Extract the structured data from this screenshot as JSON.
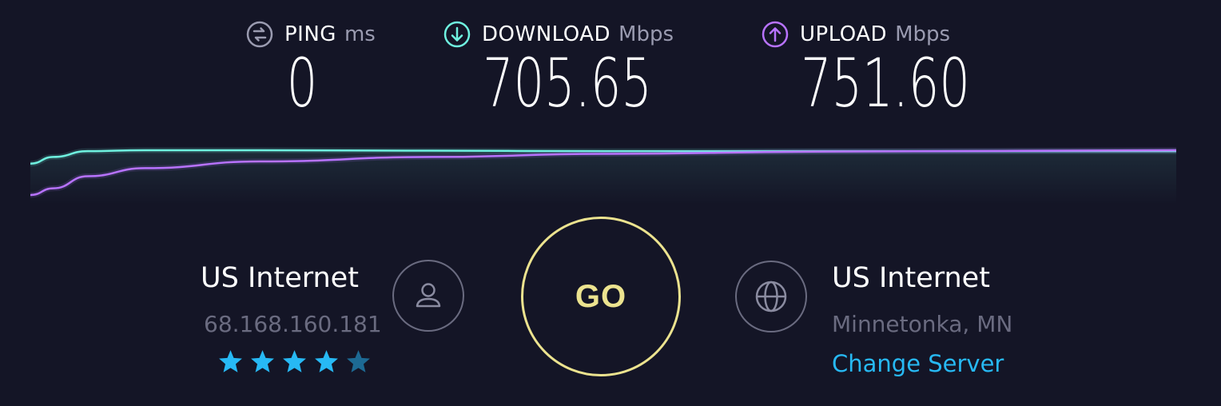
{
  "metrics": {
    "ping": {
      "label": "PING",
      "unit": "ms",
      "value": "0",
      "icon": "ping-icon"
    },
    "download": {
      "label": "DOWNLOAD",
      "unit": "Mbps",
      "value": "705.65",
      "icon": "download-arrow-icon"
    },
    "upload": {
      "label": "UPLOAD",
      "unit": "Mbps",
      "value": "751.60",
      "icon": "upload-arrow-icon"
    }
  },
  "colors": {
    "background": "#141526",
    "ping": "#9a9bb0",
    "download": "#6ff2e0",
    "upload": "#b873ff",
    "go": "#ece38f",
    "link": "#27b9f4",
    "star_on": "#27b9f4",
    "star_off": "#1d6a94",
    "muted": "#6a6b80"
  },
  "client": {
    "isp": "US Internet",
    "ip": "68.168.160.181",
    "rating": 4,
    "rating_max": 5,
    "icon": "user-icon"
  },
  "server": {
    "name": "US Internet",
    "location": "Minnetonka, MN",
    "change_label": "Change Server",
    "icon": "globe-icon"
  },
  "go": {
    "label": "GO"
  },
  "chart_data": {
    "type": "line",
    "x": [
      0,
      2,
      5,
      10,
      20,
      35,
      50,
      70,
      100
    ],
    "series": [
      {
        "values": [
          0.7,
          0.85,
          0.98,
          1.0,
          1.0,
          0.99,
          0.98,
          0.98,
          0.98
        ]
      },
      {
        "values": [
          0.0,
          0.15,
          0.42,
          0.6,
          0.75,
          0.85,
          0.92,
          0.97,
          1.0
        ]
      }
    ],
    "ylim": [
      0,
      1
    ],
    "grid": false
  }
}
